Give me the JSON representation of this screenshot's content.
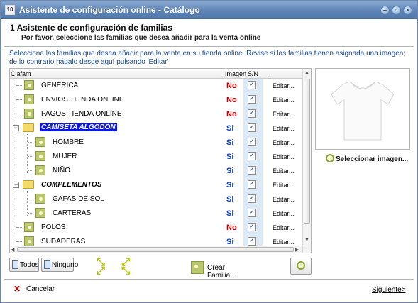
{
  "window": {
    "title": "Asistente de configuración online - Catálogo",
    "app_icon": "10"
  },
  "header": {
    "title": "1  Asistente de configuración de familias",
    "subtitle": "Por favor, seleccione las familias que desea añadir para la venta online"
  },
  "instructions": "Seleccione las familias que desea añadir para la venta en su tienda online. Revise si las familias tienen asignada una imagen; de lo contrario hágalo desde aquí pulsando 'Editar'",
  "tree": {
    "columns": {
      "name": "Clafam",
      "image": "Imagen",
      "sn": "S/N",
      "extra": "."
    },
    "rows": [
      {
        "name": "GENERICA",
        "image": "No",
        "checked": true,
        "edit": "Editar..."
      },
      {
        "name": "ENVIOS TIENDA ONLINE",
        "image": "No",
        "checked": true,
        "edit": "Editar..."
      },
      {
        "name": "PAGOS TIENDA ONLINE",
        "image": "No",
        "checked": true,
        "edit": "Editar..."
      },
      {
        "name": "CAMISETA ALGODÓN",
        "image": "Si",
        "checked": true,
        "edit": "Editar..."
      },
      {
        "name": "HOMBRE",
        "image": "Si",
        "checked": true,
        "edit": "Editar..."
      },
      {
        "name": "MUJER",
        "image": "Si",
        "checked": true,
        "edit": "Editar..."
      },
      {
        "name": "NIÑO",
        "image": "Si",
        "checked": true,
        "edit": "Editar..."
      },
      {
        "name": "COMPLEMENTOS",
        "image": "Si",
        "checked": true,
        "edit": "Editar..."
      },
      {
        "name": "GAFAS DE SOL",
        "image": "Si",
        "checked": true,
        "edit": "Editar..."
      },
      {
        "name": "CARTERAS",
        "image": "Si",
        "checked": true,
        "edit": "Editar..."
      },
      {
        "name": "POLOS",
        "image": "No",
        "checked": true,
        "edit": "Editar..."
      },
      {
        "name": "SUDADERAS",
        "image": "Si",
        "checked": true,
        "edit": "Editar..."
      }
    ]
  },
  "preview": {
    "select_label": "Seleccionar imagen..."
  },
  "buttons": {
    "todos": "Todos",
    "ninguno": "Ninguno",
    "crear": "Crear Familia...",
    "cancel": "Cancelar",
    "next": "Siguiente>"
  },
  "colors": {
    "accent": "#5479ab",
    "selected": "#0b18e6",
    "no": "#c50000",
    "si": "#0b3fc8"
  }
}
